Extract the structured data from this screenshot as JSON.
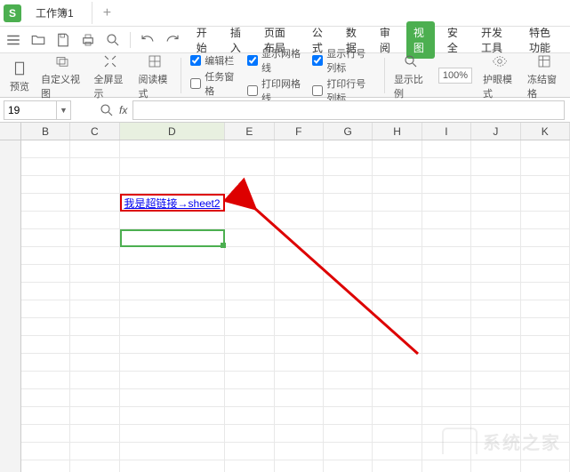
{
  "titlebar": {
    "app_glyph": "S",
    "workbook_name": "工作簿1",
    "add_glyph": "+"
  },
  "menu": {
    "tabs": [
      "开始",
      "插入",
      "页面布局",
      "公式",
      "数据",
      "审阅",
      "视图",
      "安全",
      "开发工具",
      "特色功能"
    ],
    "active_index": 6
  },
  "ribbon": {
    "preview": "预览",
    "custom_view": "自定义视图",
    "fullscreen": "全屏显示",
    "read_mode": "阅读模式",
    "checks1": [
      "编辑栏",
      "任务窗格"
    ],
    "checks2": [
      "显示网格线",
      "打印网格线"
    ],
    "checks3": [
      "显示行号列标",
      "打印行号列标"
    ],
    "zoom": "显示比例",
    "zoom_val": "100%",
    "eye_mode": "护眼模式",
    "freeze": "冻结窗格"
  },
  "formula": {
    "namebox": "19",
    "fx": "fx"
  },
  "columns": [
    "B",
    "C",
    "D",
    "E",
    "F",
    "G",
    "H",
    "I",
    "J",
    "K"
  ],
  "hyperlink_text": "我是超链接→sheet2",
  "watermark": "系统之家"
}
